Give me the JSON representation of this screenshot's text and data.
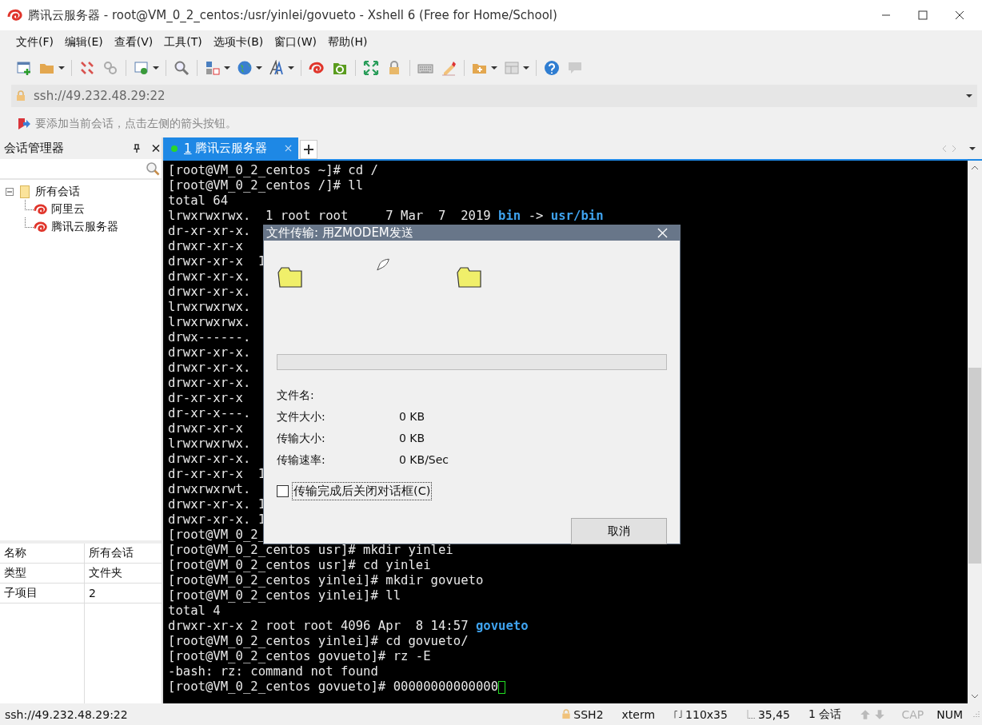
{
  "window": {
    "title": "腾讯云服务器 - root@VM_0_2_centos:/usr/yinlei/govueto - Xshell 6 (Free for Home/School)"
  },
  "menu": [
    "文件(F)",
    "编辑(E)",
    "查看(V)",
    "工具(T)",
    "选项卡(B)",
    "窗口(W)",
    "帮助(H)"
  ],
  "address": {
    "value": "ssh://49.232.48.29:22"
  },
  "hint": "要添加当前会话，点击左侧的箭头按钮。",
  "session_manager": {
    "title": "会话管理器",
    "tree": [
      {
        "label": "所有会话",
        "expanded": true,
        "children": [
          {
            "label": "阿里云"
          },
          {
            "label": "腾讯云服务器"
          }
        ]
      }
    ],
    "properties": [
      {
        "name": "名称",
        "value": "所有会话"
      },
      {
        "name": "类型",
        "value": "文件夹"
      },
      {
        "name": "子项目",
        "value": "2"
      }
    ]
  },
  "tabs": [
    {
      "number": "1",
      "label": "腾讯云服务器",
      "selected": true
    }
  ],
  "terminal": {
    "lines": [
      {
        "kind": "plain",
        "text": "[root@VM_0_2_centos ~]# cd /"
      },
      {
        "kind": "plain",
        "text": "[root@VM_0_2_centos /]# ll"
      },
      {
        "kind": "plain",
        "text": "total 64"
      },
      {
        "kind": "parts",
        "parts": [
          {
            "kind": "plain",
            "text": "lrwxrwxrwx.  1 root root     7 Mar  7  2019 "
          },
          {
            "kind": "dir",
            "text": "bin"
          },
          {
            "kind": "plain",
            "text": " -> "
          },
          {
            "kind": "dir",
            "text": "usr/bin"
          }
        ]
      },
      {
        "kind": "plain",
        "text": "dr-xr-xr-x."
      },
      {
        "kind": "plain",
        "text": "drwxr-xr-x"
      },
      {
        "kind": "plain",
        "text": "drwxr-xr-x  1"
      },
      {
        "kind": "plain",
        "text": "drwxr-xr-x."
      },
      {
        "kind": "plain",
        "text": "drwxr-xr-x."
      },
      {
        "kind": "plain",
        "text": "lrwxrwxrwx."
      },
      {
        "kind": "plain",
        "text": "lrwxrwxrwx."
      },
      {
        "kind": "plain",
        "text": "drwx------."
      },
      {
        "kind": "plain",
        "text": "drwxr-xr-x."
      },
      {
        "kind": "plain",
        "text": "drwxr-xr-x."
      },
      {
        "kind": "plain",
        "text": "drwxr-xr-x."
      },
      {
        "kind": "plain",
        "text": "dr-xr-xr-x"
      },
      {
        "kind": "plain",
        "text": "dr-xr-x---."
      },
      {
        "kind": "plain",
        "text": "drwxr-xr-x"
      },
      {
        "kind": "plain",
        "text": "lrwxrwxrwx."
      },
      {
        "kind": "plain",
        "text": "drwxr-xr-x."
      },
      {
        "kind": "plain",
        "text": "dr-xr-xr-x  1"
      },
      {
        "kind": "plain",
        "text": "drwxrwxrwt."
      },
      {
        "kind": "plain",
        "text": "drwxr-xr-x. 1"
      },
      {
        "kind": "plain",
        "text": "drwxr-xr-x. 1"
      },
      {
        "kind": "plain",
        "text": "[root@VM_0_2_"
      },
      {
        "kind": "plain",
        "text": "[root@VM_0_2_centos usr]# mkdir yinlei"
      },
      {
        "kind": "plain",
        "text": "[root@VM_0_2_centos usr]# cd yinlei"
      },
      {
        "kind": "plain",
        "text": "[root@VM_0_2_centos yinlei]# mkdir govueto"
      },
      {
        "kind": "plain",
        "text": "[root@VM_0_2_centos yinlei]# ll"
      },
      {
        "kind": "plain",
        "text": "total 4"
      },
      {
        "kind": "parts",
        "parts": [
          {
            "kind": "plain",
            "text": "drwxr-xr-x 2 root root 4096 Apr  8 14:57 "
          },
          {
            "kind": "dir",
            "text": "govueto"
          }
        ]
      },
      {
        "kind": "plain",
        "text": "[root@VM_0_2_centos yinlei]# cd govueto/"
      },
      {
        "kind": "plain",
        "text": "[root@VM_0_2_centos govueto]# rz -E"
      },
      {
        "kind": "plain",
        "text": "-bash: rz: command not found"
      },
      {
        "kind": "input",
        "text": "[root@VM_0_2_centos govueto]# 00000000000000"
      }
    ]
  },
  "dialog": {
    "title": "文件传输: 用ZMODEM发送",
    "progress": {
      "level": 0
    },
    "fields": [
      {
        "label": "文件名:"
      },
      {
        "label": "文件大小:",
        "value": "0 KB"
      },
      {
        "label": "传输大小:",
        "value": "0 KB"
      },
      {
        "label": "传输速率:",
        "value": "0 KB/Sec"
      }
    ],
    "checkbox": {
      "label": "传输完成后关闭对话框(C)",
      "checked": false
    },
    "buttons": [
      "取消"
    ]
  },
  "status_bar": {
    "address": "ssh://49.232.48.29:22",
    "items": [
      {
        "kind": "protocol",
        "text": "SSH2"
      },
      {
        "kind": "plain",
        "text": "xterm"
      },
      {
        "kind": "size",
        "text": "110x35"
      },
      {
        "kind": "cursor",
        "text": "35,45"
      },
      {
        "kind": "plain",
        "text": "1 会话"
      }
    ],
    "indicators": [
      {
        "text": "CAP",
        "on": false
      },
      {
        "text": "NUM",
        "on": true
      }
    ]
  }
}
